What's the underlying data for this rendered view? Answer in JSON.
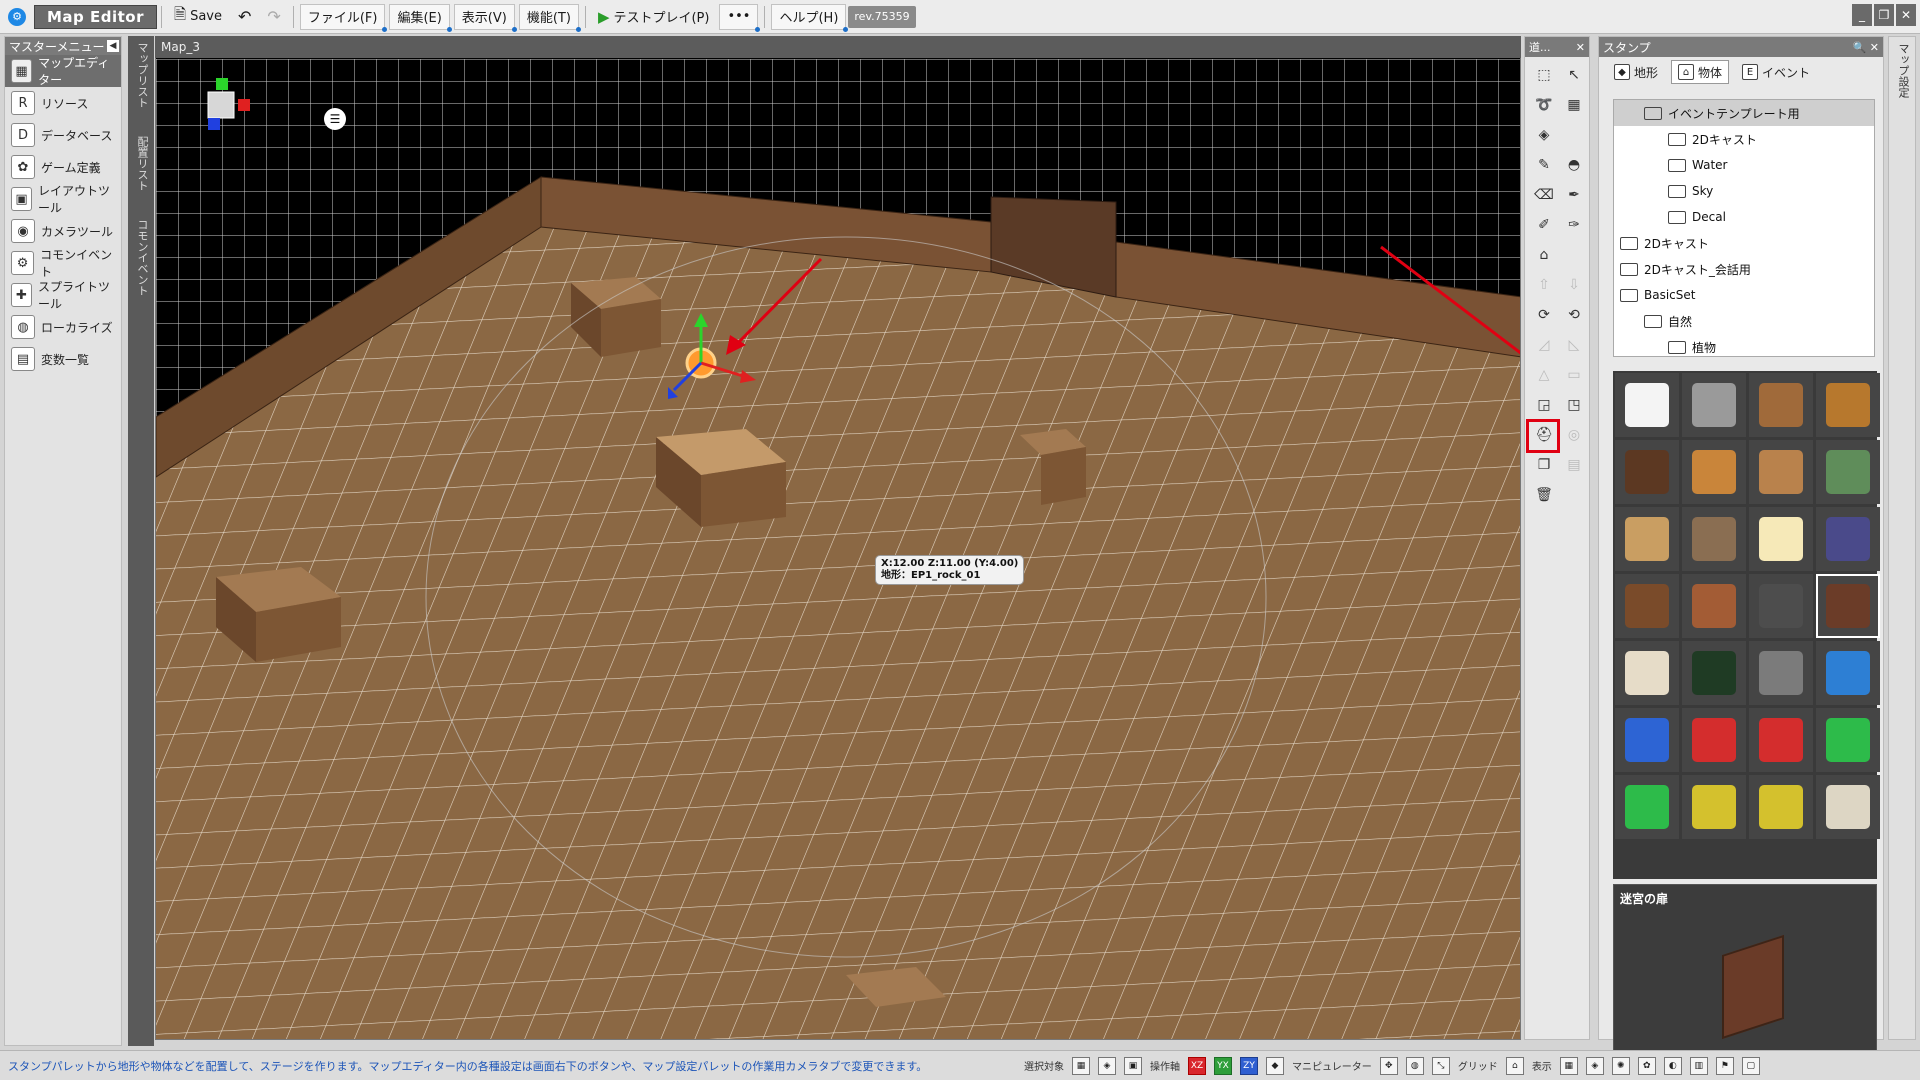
{
  "app": {
    "logo": "⚙",
    "title": "Map Editor",
    "revision": "rev.75359"
  },
  "toolbar": {
    "save": "Save",
    "file": "ファイル(F)",
    "edit": "編集(E)",
    "view": "表示(V)",
    "function": "機能(T)",
    "testplay": "テストプレイ(P)",
    "more": "•••",
    "help": "ヘルプ(H)"
  },
  "window_controls": [
    "_",
    "❐",
    "✕"
  ],
  "sidebar": {
    "title": "マスターメニュー",
    "items": [
      {
        "label": "マップエディター",
        "icon": "map-icon",
        "glyph": "▦"
      },
      {
        "label": "リソース",
        "icon": "resource-icon",
        "glyph": "R"
      },
      {
        "label": "データベース",
        "icon": "database-icon",
        "glyph": "D"
      },
      {
        "label": "ゲーム定義",
        "icon": "gear-icon",
        "glyph": "✿"
      },
      {
        "label": "レイアウトツール",
        "icon": "layout-icon",
        "glyph": "▣"
      },
      {
        "label": "カメラツール",
        "icon": "camera-icon",
        "glyph": "◉"
      },
      {
        "label": "コモンイベント",
        "icon": "common-event-icon",
        "glyph": "⚙"
      },
      {
        "label": "スプライトツール",
        "icon": "sprite-icon",
        "glyph": "✚"
      },
      {
        "label": "ローカライズ",
        "icon": "localize-icon",
        "glyph": "◍"
      },
      {
        "label": "変数一覧",
        "icon": "variable-icon",
        "glyph": "▤"
      }
    ]
  },
  "vertical_tabs": [
    "マップリスト",
    "配置リスト",
    "コモンイベント"
  ],
  "viewport": {
    "tab": "Map_3",
    "tooltip_line1": "X:12.00 Z:11.00 (Y:4.00)",
    "tooltip_line2": "地形：EP1_rock_01"
  },
  "tools_panel": {
    "title": "道..."
  },
  "stamp": {
    "title": "スタンプ",
    "tabs": [
      "地形",
      "物体",
      "イベント"
    ],
    "tree": [
      {
        "label": "イベントテンプレート用",
        "depth": 1,
        "selected": true
      },
      {
        "label": "2Dキャスト",
        "depth": 2
      },
      {
        "label": "Water",
        "depth": 2
      },
      {
        "label": "Sky",
        "depth": 2
      },
      {
        "label": "Decal",
        "depth": 2
      },
      {
        "label": "2Dキャスト",
        "depth": 0
      },
      {
        "label": "2Dキャスト_会話用",
        "depth": 0
      },
      {
        "label": "BasicSet",
        "depth": 0
      },
      {
        "label": "自然",
        "depth": 1
      },
      {
        "label": "植物",
        "depth": 2
      }
    ],
    "thumbnails": [
      {
        "color": "#f4f4f4",
        "sel": false
      },
      {
        "color": "#9a9a9a",
        "sel": false
      },
      {
        "color": "#a06a3a",
        "sel": false
      },
      {
        "color": "#b7782d",
        "sel": false
      },
      {
        "color": "#5c3822",
        "sel": false
      },
      {
        "color": "#c9853a",
        "sel": false
      },
      {
        "color": "#b9824c",
        "sel": false
      },
      {
        "color": "#5f8d5a",
        "sel": false
      },
      {
        "color": "#c99e62",
        "sel": false
      },
      {
        "color": "#8a6e52",
        "sel": false
      },
      {
        "color": "#f6e9b8",
        "sel": false
      },
      {
        "color": "#4a4a8a",
        "sel": false
      },
      {
        "color": "#7a4b2a",
        "sel": false
      },
      {
        "color": "#a35c35",
        "sel": false
      },
      {
        "color": "#4d4d4d",
        "sel": false
      },
      {
        "color": "#6b3c28",
        "sel": true
      },
      {
        "color": "#e6dcc8",
        "sel": false
      },
      {
        "color": "#1f3b24",
        "sel": false
      },
      {
        "color": "#7b7b7b",
        "sel": false
      },
      {
        "color": "#2d7fd4",
        "sel": false
      },
      {
        "color": "#2d64d4",
        "sel": false
      },
      {
        "color": "#d42d2d",
        "sel": false
      },
      {
        "color": "#d42d2d",
        "sel": false
      },
      {
        "color": "#2dbb4a",
        "sel": false
      },
      {
        "color": "#2dbb4a",
        "sel": false
      },
      {
        "color": "#d4c12d",
        "sel": false
      },
      {
        "color": "#d4c12d",
        "sel": false
      },
      {
        "color": "#ddd6c4",
        "sel": false
      }
    ],
    "preview_title": "迷宮の扉"
  },
  "right_tab": "マップ設定",
  "status": {
    "message": "スタンプパレットから地形や物体などを配置して、ステージを作ります。マップエディター内の各種設定は画面右下のボタンや、マップ設定パレットの作業用カメラタブで変更できます。",
    "select_target": "選択対象",
    "axis": "操作軸",
    "axis_xz": "XZ",
    "axis_yx": "YX",
    "axis_zy": "ZY",
    "manipulator": "マニピュレーター",
    "grid": "グリッド",
    "display": "表示"
  }
}
